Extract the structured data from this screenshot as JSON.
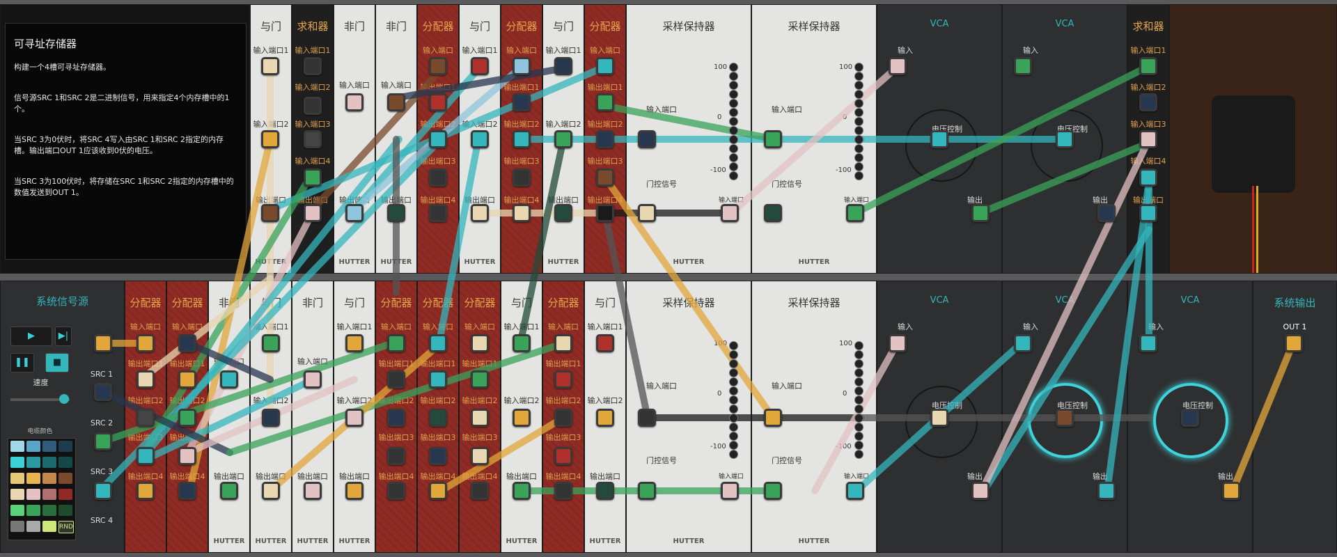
{
  "description": {
    "title": "可寻址存储器",
    "paragraphs": [
      "构建一个4槽可寻址存储器。",
      "信号源SRC 1和SRC 2是二进制信号，用来指定4个内存槽中的1个。",
      "当SRC 3为0伏时，将SRC 4写入由SRC 1和SRC 2指定的内存槽。输出端口OUT 1应该收到0伏的电压。",
      "当SRC 3为100伏时，将存储在SRC 1和SRC 2指定的内存槽中的数值发送到OUT 1。"
    ]
  },
  "labels": {
    "and_gate": "与门",
    "not_gate": "非门",
    "splitter": "分配器",
    "summer": "求和器",
    "sample_hold": "采样保持器",
    "vca": "VCA",
    "input": "输入端口",
    "input1": "输入端口1",
    "input2": "输入端口2",
    "input3": "输入端口3",
    "input4": "输入端口4",
    "output": "输出端口",
    "output1": "输出端口1",
    "output2": "输出端口2",
    "output3": "输出端口3",
    "output4": "输出端口4",
    "gate": "门控信号",
    "cv": "电压控制",
    "vca_in": "输入",
    "vca_out": "输出",
    "brand": "HUTTER",
    "scale_top": "100",
    "scale_mid": "0",
    "scale_bot": "-100"
  },
  "source_panel": {
    "title": "系统信号源",
    "sources": [
      "SRC 1",
      "SRC 2",
      "SRC 3",
      "SRC 4"
    ],
    "speed_label": "速度",
    "color_label": "电缆颜色",
    "random_label": "RND",
    "play_icon": "play-icon",
    "step_icon": "step-icon",
    "pause_icon": "pause-icon",
    "stop_icon": "stop-icon"
  },
  "output_panel": {
    "title": "系统输出",
    "port": "OUT 1"
  },
  "colors": {
    "teal": "#34b6bd",
    "cream": "#e8d7b0",
    "pink": "#e3c2c4",
    "yellow": "#e2a73a",
    "green": "#3aa35a",
    "navy": "#27374f",
    "darkgreen": "#234a3a",
    "red": "#b0302b",
    "brown": "#7a4a2c",
    "gray": "#555",
    "black": "#1a1a1a",
    "lightblue": "#8fc6dd"
  },
  "palette": [
    "#9fd8e8",
    "#5aa6c8",
    "#2e5c7a",
    "#1d3d4e",
    "#3ad0d8",
    "#2a9aa0",
    "#1b6a6e",
    "#174848",
    "#e8c876",
    "#e8b450",
    "#c4884a",
    "#7a4a2c",
    "#e8d7b0",
    "#e3c2c4",
    "#b07070",
    "#8e2b24",
    "#5ad27a",
    "#3aa35a",
    "#2b6e3e",
    "#1f4a2c",
    "#777777",
    "#aaaaaa",
    "#cfe87a",
    ""
  ]
}
